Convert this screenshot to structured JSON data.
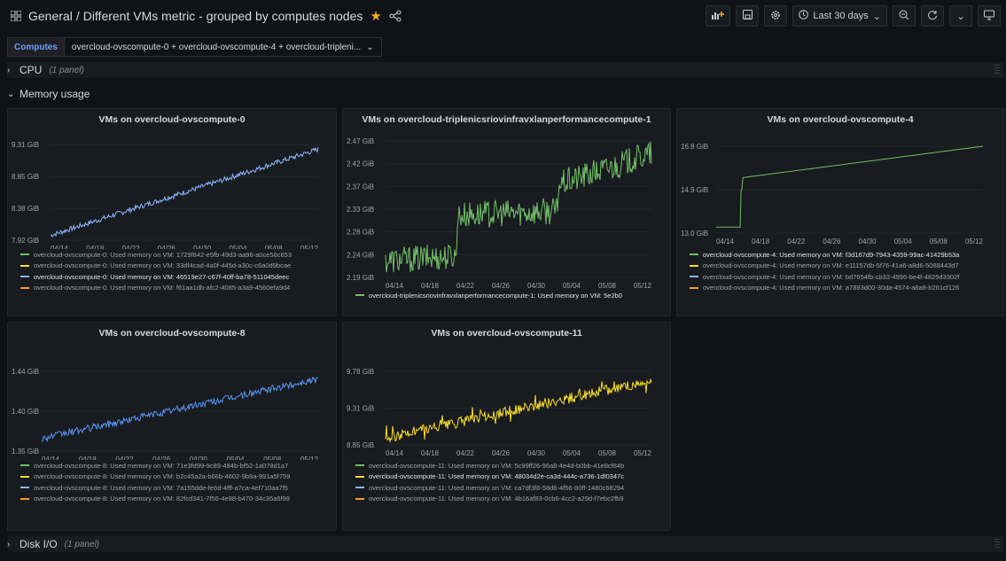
{
  "topbar": {
    "section": "General",
    "separator": "/",
    "dashboard_title": "Different VMs metric - grouped by computes nodes",
    "time_range": "Last 30 days"
  },
  "variables": {
    "label": "Computes",
    "value": "overcloud-ovscompute-0 + overcloud-ovscompute-4 + overcloud-tripleni..."
  },
  "rows": {
    "cpu": {
      "title": "CPU",
      "count": "(1 panel)"
    },
    "memory": {
      "title": "Memory usage"
    },
    "disk": {
      "title": "Disk I/O",
      "count": "(1 panel)"
    }
  },
  "colors": {
    "green": "#73bf69",
    "yellow": "#fade2a",
    "blue": "#8ab8ff",
    "orange": "#ff9830"
  },
  "panels": [
    {
      "title": "VMs on overcloud-ovscompute-0",
      "chart_data": {
        "type": "line",
        "y_ticks": [
          "9.31 GiB",
          "8.85 GiB",
          "8.38 GiB",
          "7.92 GiB"
        ],
        "x_ticks": [
          "04/14",
          "04/18",
          "04/22",
          "04/26",
          "04/30",
          "05/04",
          "05/08",
          "05/12"
        ],
        "series_color": "#8ab8ff",
        "start": 0.0,
        "end": 1.0,
        "jump_at": null,
        "noise": 0.06
      },
      "legend": [
        {
          "text": "overcloud-ovscompute-0: Used memory on VM: 1729f842-e5fb-49d3-aa96-a0ce56c653",
          "color": "#73bf69",
          "highlight": false
        },
        {
          "text": "overcloud-ovscompute-0: Used memory on VM: 33df4cad-4a0f-445d-a30c-c6a0d9bcae",
          "color": "#fade2a",
          "highlight": false
        },
        {
          "text": "overcloud-ovscompute-0: Used memory on VM: 46519e27-c67f-40ff-ba78-511045deec",
          "color": "#8ab8ff",
          "highlight": true
        },
        {
          "text": "overcloud-ovscompute-0: Used memory on VM: f61aa1db-afc2-4085-a3a9-4560efa9d4",
          "color": "#ff9830",
          "highlight": false
        }
      ]
    },
    {
      "title": "VMs on overcloud-triplenicsriovinfravxlanperformancecompute-1",
      "chart_data": {
        "type": "line",
        "y_ticks": [
          "2.47 GiB",
          "2.42 GiB",
          "2.37 GiB",
          "2.33 GiB",
          "2.28 GiB",
          "2.24 GiB",
          "2.19 GiB"
        ],
        "x_ticks": [
          "04/14",
          "04/18",
          "04/22",
          "04/26",
          "04/30",
          "05/04",
          "05/08",
          "05/12"
        ],
        "series_color": "#73bf69",
        "start": 0.06,
        "end": 0.9,
        "jump_at": 0.27,
        "noise": 0.22
      },
      "legend": [
        {
          "text": "overcloud-triplenicsriovinfravxlanperformancecompute-1: Used memory on VM: 5e2b0",
          "color": "#73bf69",
          "highlight": true
        }
      ]
    },
    {
      "title": "VMs on overcloud-ovscompute-4",
      "chart_data": {
        "type": "line",
        "y_ticks": [
          "16.8 GiB",
          "14.9 GiB",
          "13.0 GiB"
        ],
        "x_ticks": [
          "04/14",
          "04/18",
          "04/22",
          "04/26",
          "04/30",
          "05/04",
          "05/08",
          "05/12"
        ],
        "series_color": "#73bf69",
        "start": 0.0,
        "end": 1.0,
        "jump_at": 0.1,
        "noise": 0.0
      },
      "legend": [
        {
          "text": "overcloud-ovscompute-4: Used memory on VM: f3d167d9-7943-4359-99ac-41429b53a",
          "color": "#73bf69",
          "highlight": true
        },
        {
          "text": "overcloud-ovscompute-4: Used memory on VM: e11157db-5f76-41a6-a8d6-5088443d7",
          "color": "#fade2a",
          "highlight": false
        },
        {
          "text": "overcloud-ovscompute-4: Used memory on VM: bd7654fb-cb33-4996-be4f-4825d3302f",
          "color": "#8ab8ff",
          "highlight": false
        },
        {
          "text": "overcloud-ovscompute-4: Used memory on VM: a7883d00-30da-4574-a8a8-b261cf126",
          "color": "#ff9830",
          "highlight": false
        }
      ]
    },
    {
      "title": "VMs on overcloud-ovscompute-8",
      "chart_data": {
        "type": "line",
        "y_ticks": [
          "1.44 GiB",
          "1.40 GiB",
          "1.35 GiB"
        ],
        "x_ticks": [
          "04/14",
          "04/18",
          "04/22",
          "04/26",
          "04/30",
          "05/04",
          "05/08",
          "05/12"
        ],
        "series_color": "#5794f2",
        "start": 0.12,
        "end": 0.95,
        "jump_at": null,
        "noise": 0.1
      },
      "legend": [
        {
          "text": "overcloud-ovscompute-8: Used memory on VM: 71e3fd99-9c89-484b-bf52-1a078d1a7",
          "color": "#73bf69",
          "highlight": false
        },
        {
          "text": "overcloud-ovscompute-8: Used memory on VM: b2c45a2a-b66b-4602-9b9a-991a5f759",
          "color": "#fade2a",
          "highlight": false
        },
        {
          "text": "overcloud-ovscompute-8: Used memory on VM: 7a155dde-fe6d-4fff-a7ca-4ef710aa7f5",
          "color": "#8ab8ff",
          "highlight": false
        },
        {
          "text": "overcloud-ovscompute-8: Used memory on VM: 82fcd341-7f56-4e88-b470-34c35a6f99",
          "color": "#ff9830",
          "highlight": false
        }
      ]
    },
    {
      "title": "VMs on overcloud-ovscompute-11",
      "chart_data": {
        "type": "line",
        "y_ticks": [
          "9.78 GiB",
          "9.31 GiB",
          "8.85 GiB"
        ],
        "x_ticks": [
          "04/14",
          "04/18",
          "04/22",
          "04/26",
          "04/30",
          "05/04",
          "05/08",
          "05/12"
        ],
        "series_color": "#fade2a",
        "start": 0.05,
        "end": 0.92,
        "jump_at": null,
        "noise": 0.16
      },
      "legend": [
        {
          "text": "overcloud-ovscompute-11: Used memory on VM: 5c99ff26-96a8-4e4d-b0bb-41e8cf84b",
          "color": "#73bf69",
          "highlight": false
        },
        {
          "text": "overcloud-ovscompute-11: Used memory on VM: 48034d2e-ca3d-444c-a736-1df0347c",
          "color": "#fade2a",
          "highlight": true
        },
        {
          "text": "overcloud-ovscompute-11: Used memory on VM: ca7df3f8-58d6-4f56-80ff-1480c68294",
          "color": "#8ab8ff",
          "highlight": false
        },
        {
          "text": "overcloud-ovscompute-11: Used memory on VM: 4b16af83-0cb6-4cc2-a29d-f7ebc2fb9",
          "color": "#ff9830",
          "highlight": false
        }
      ]
    }
  ]
}
